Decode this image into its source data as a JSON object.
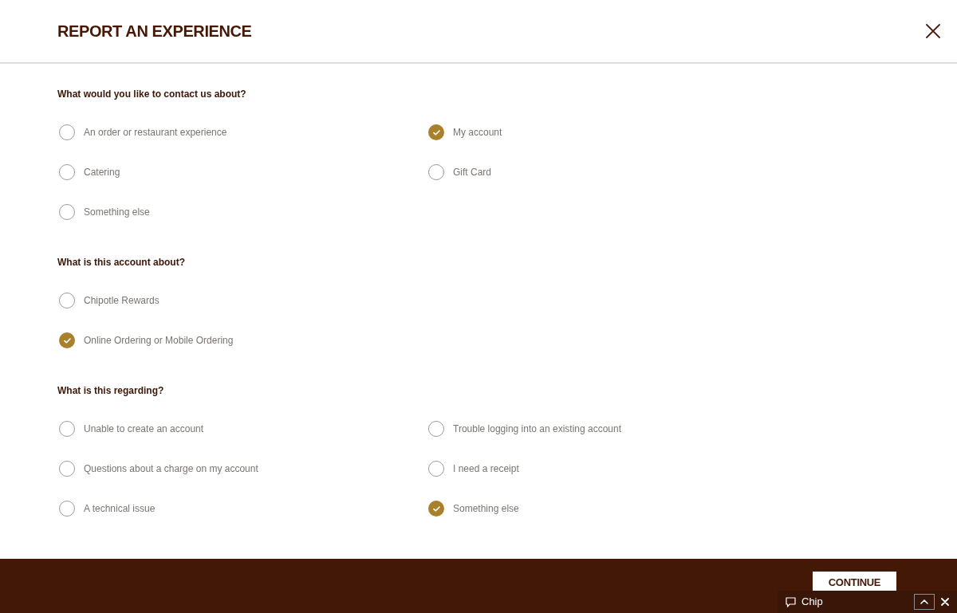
{
  "header": {
    "title": "REPORT AN EXPERIENCE"
  },
  "sections": [
    {
      "question": "What would you like to contact us about?",
      "options": [
        {
          "label": "An order or restaurant experience",
          "selected": false
        },
        {
          "label": "Catering",
          "selected": false
        },
        {
          "label": "Something else",
          "selected": false
        },
        {
          "label": "My account",
          "selected": true
        },
        {
          "label": "Gift Card",
          "selected": false
        }
      ]
    },
    {
      "question": "What is this account about?",
      "options": [
        {
          "label": "Chipotle Rewards",
          "selected": false
        },
        {
          "label": "Online Ordering or Mobile Ordering",
          "selected": true
        }
      ]
    },
    {
      "question": "What is this regarding?",
      "options": [
        {
          "label": "Unable to create an account",
          "selected": false
        },
        {
          "label": "Questions about a charge on my account",
          "selected": false
        },
        {
          "label": "A technical issue",
          "selected": false
        },
        {
          "label": "Trouble logging into an existing account",
          "selected": false
        },
        {
          "label": "I need a receipt",
          "selected": false
        },
        {
          "label": "Something else",
          "selected": true
        }
      ]
    }
  ],
  "footer": {
    "continue_button": "CONTINUE"
  },
  "chat_widget": {
    "label": "Chip"
  }
}
